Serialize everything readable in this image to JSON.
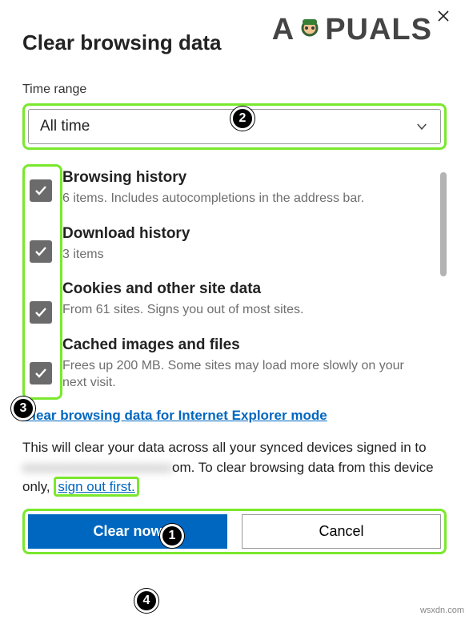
{
  "title": "Clear browsing data",
  "time_range_label": "Time range",
  "time_range_value": "All time",
  "items": [
    {
      "title": "Browsing history",
      "desc": "6 items. Includes autocompletions in the address bar."
    },
    {
      "title": "Download history",
      "desc": "3 items"
    },
    {
      "title": "Cookies and other site data",
      "desc": "From 61 sites. Signs you out of most sites."
    },
    {
      "title": "Cached images and files",
      "desc": "Frees up 200 MB. Some sites may load more slowly on your next visit."
    }
  ],
  "ie_link": "Clear browsing data for Internet Explorer mode",
  "info_prefix": "This will clear your data across all your synced devices signed in to ",
  "info_blur": "xxxxxxxxxxxxxxxxxxxxxx",
  "info_mid": "om. To clear browsing data from this device only, ",
  "signout_link": "sign out first.",
  "clear_btn": "Clear now",
  "cancel_btn": "Cancel",
  "watermark_a": "A",
  "watermark_rest": "PUALS",
  "badges": {
    "b1": "1",
    "b2": "2",
    "b3": "3",
    "b4": "4"
  },
  "credit": "wsxdn.com"
}
